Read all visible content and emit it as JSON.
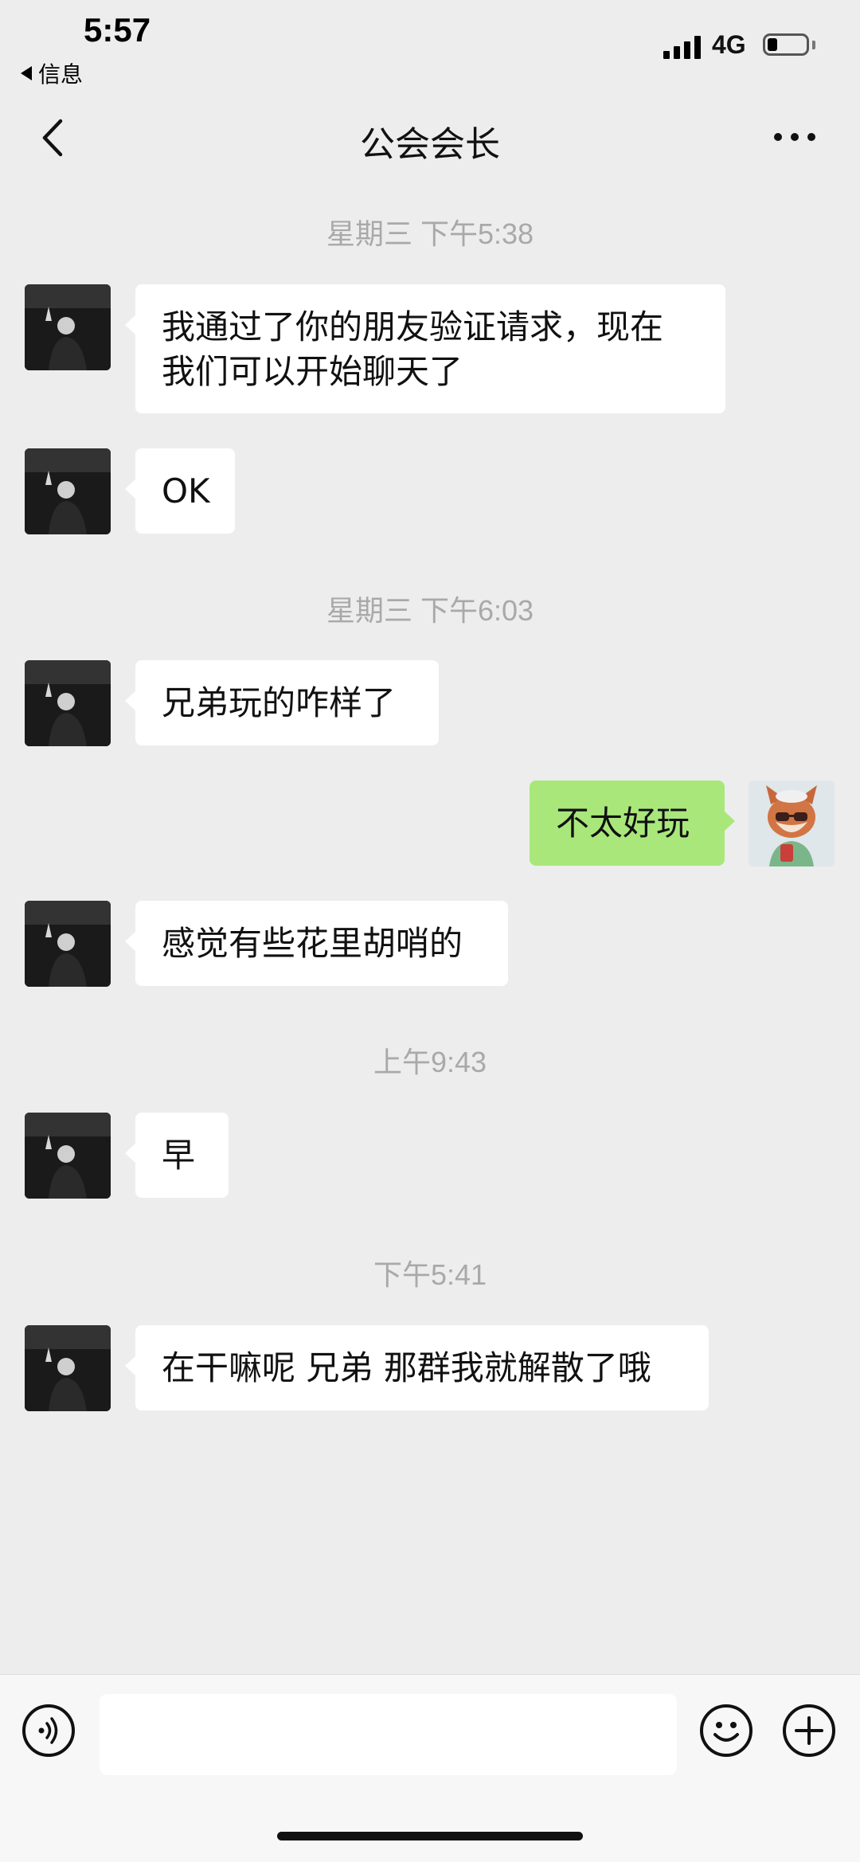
{
  "status_bar": {
    "time": "5:57",
    "back_app": "信息",
    "network": "4G"
  },
  "nav": {
    "title": "公会会长",
    "back_icon": "chevron-left-icon",
    "more_icon": "more-horizontal-icon"
  },
  "timestamps": [
    "星期三 下午5:38",
    "星期三 下午6:03",
    "上午9:43",
    "下午5:41"
  ],
  "messages": [
    {
      "side": "in",
      "lines": [
        "我通过了你的朋友验证请求，现在",
        "我们可以开始聊天了"
      ]
    },
    {
      "side": "in",
      "lines": [
        "OK"
      ]
    },
    {
      "side": "in",
      "lines": [
        "兄弟玩的咋样了"
      ]
    },
    {
      "side": "out",
      "lines": [
        "不太好玩"
      ]
    },
    {
      "side": "in",
      "lines": [
        "感觉有些花里胡哨的"
      ]
    },
    {
      "side": "in",
      "lines": [
        "早"
      ]
    },
    {
      "side": "in",
      "lines": [
        "在干嘛呢 兄弟 那群我就解散了哦"
      ]
    }
  ],
  "input_bar": {
    "voice_icon": "voice-icon",
    "emoji_icon": "emoji-icon",
    "plus_icon": "plus-icon",
    "text_value": ""
  },
  "colors": {
    "background": "#ededed",
    "incoming_bubble": "#ffffff",
    "outgoing_bubble": "#a9e77b",
    "timestamp_text": "#a9a9a9"
  }
}
